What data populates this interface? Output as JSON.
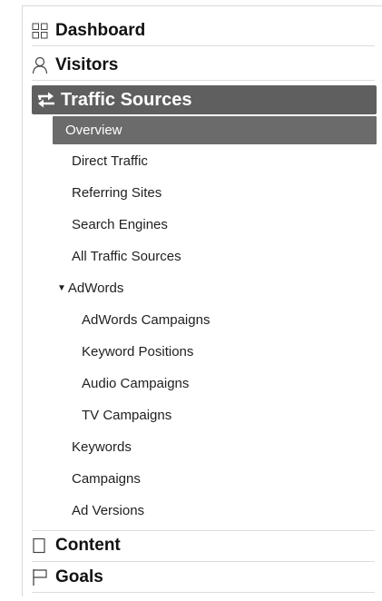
{
  "nav": {
    "dashboard": {
      "label": "Dashboard",
      "icon": "grid-icon"
    },
    "visitors": {
      "label": "Visitors",
      "icon": "person-icon"
    },
    "traffic_sources": {
      "label": "Traffic Sources",
      "icon": "traffic-arrows-icon",
      "items": [
        {
          "label": "Overview"
        },
        {
          "label": "Direct Traffic"
        },
        {
          "label": "Referring Sites"
        },
        {
          "label": "Search Engines"
        },
        {
          "label": "All Traffic Sources"
        },
        {
          "label": "AdWords"
        },
        {
          "label": "AdWords Campaigns"
        },
        {
          "label": "Keyword Positions"
        },
        {
          "label": "Audio Campaigns"
        },
        {
          "label": "TV Campaigns"
        },
        {
          "label": "Keywords"
        },
        {
          "label": "Campaigns"
        },
        {
          "label": "Ad Versions"
        }
      ]
    },
    "content": {
      "label": "Content",
      "icon": "page-icon"
    },
    "goals": {
      "label": "Goals",
      "icon": "flag-icon"
    }
  },
  "colors": {
    "active_section_bg": "#5f5f5f",
    "selected_item_bg": "#6b6b6b",
    "separator": "#dcdcdc"
  }
}
